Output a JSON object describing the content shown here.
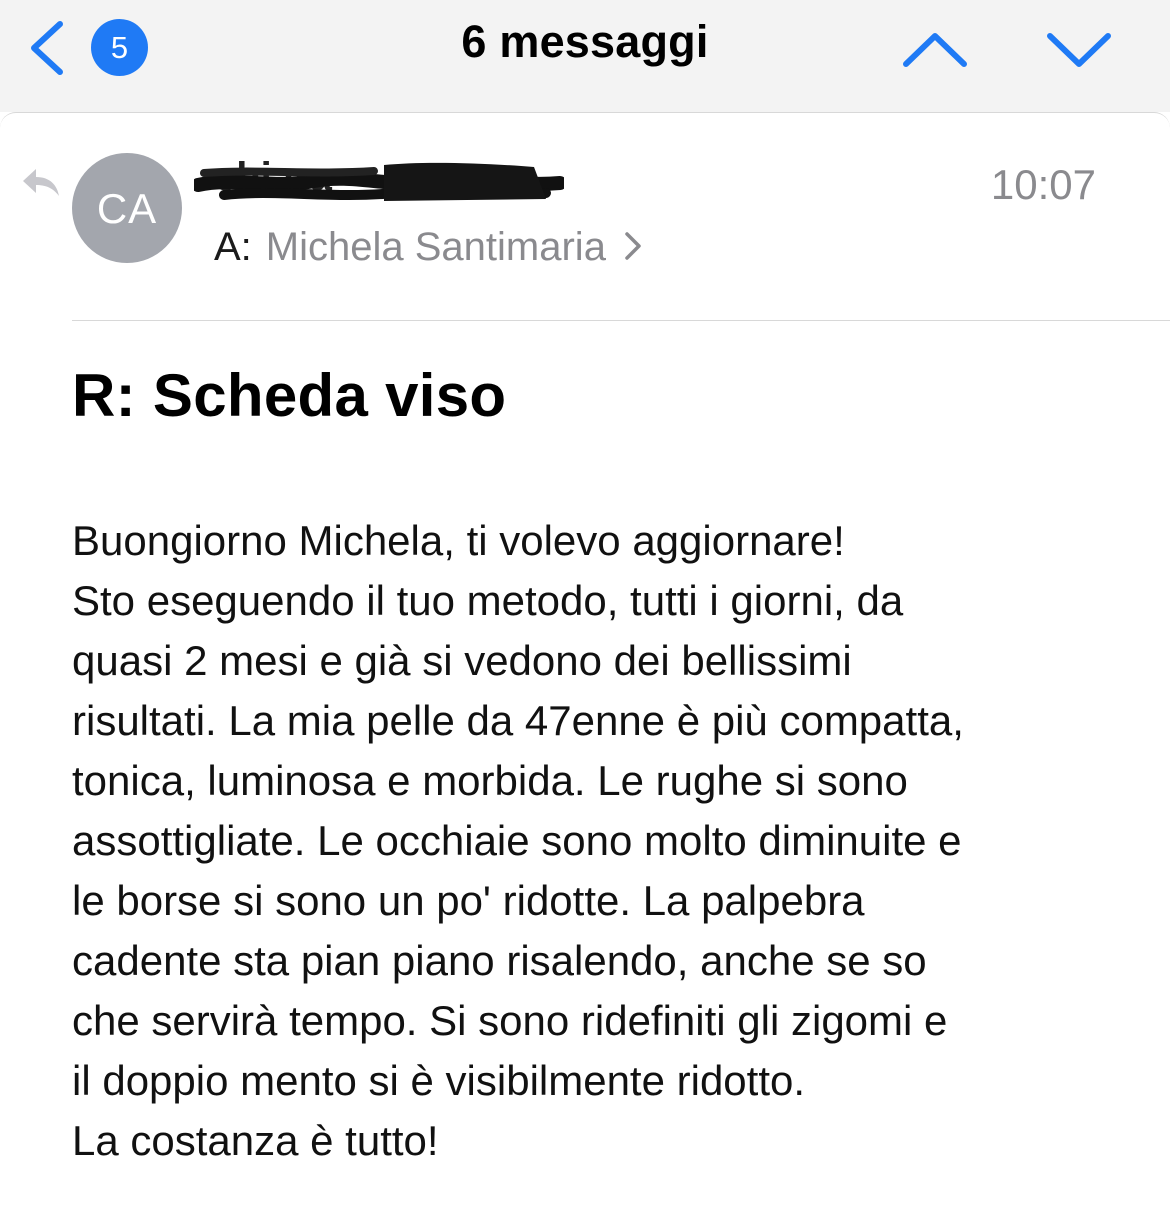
{
  "nav": {
    "unread_count": "5",
    "title": "6 messaggi"
  },
  "colors": {
    "accent": "#1f7af5",
    "nav_bg": "#f3f3f3",
    "avatar_bg": "#a3a6ad",
    "secondary_text": "#8a8a8e"
  },
  "icons": {
    "back": "chevron-left-icon",
    "previous": "chevron-up-icon",
    "next": "chevron-down-icon",
    "reply": "reply-arrow-icon",
    "recipient_disclosure": "chevron-right-icon"
  },
  "message": {
    "avatar_initials": "CA",
    "sender_visible": "chiara",
    "time": "10:07",
    "to_label": "A:",
    "to_name": "Michela Santimaria",
    "subject": "R: Scheda viso",
    "body_lines": [
      "Buongiorno Michela, ti volevo aggiornare!",
      "Sto eseguendo il tuo metodo, tutti i giorni, da",
      "quasi 2 mesi e già si vedono dei bellissimi",
      "risultati. La mia pelle da 47enne è più compatta,",
      "tonica, luminosa e morbida. Le rughe si sono",
      "assottigliate. Le occhiaie sono molto diminuite e",
      "le borse si sono un po' ridotte. La palpebra",
      "cadente sta pian piano risalendo, anche se so",
      "che servirà tempo. Si sono ridefiniti gli zigomi e",
      "il doppio mento si è visibilmente ridotto.",
      "La costanza è tutto!"
    ]
  }
}
